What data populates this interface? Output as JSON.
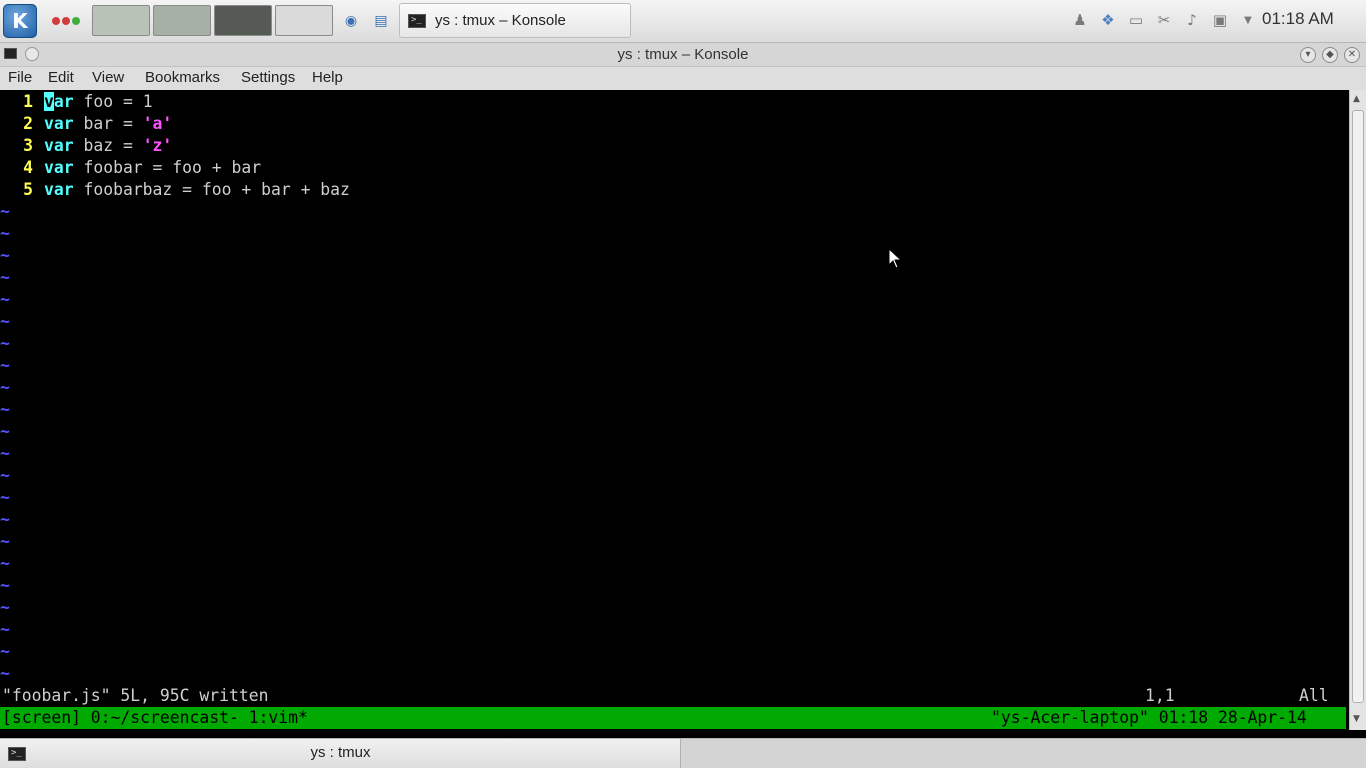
{
  "panel": {
    "launcher_icon": "kde-k-icon",
    "task_label": "ys : tmux – Konsole",
    "clock": "01:18 AM",
    "colors": {
      "red": "#d23b3b",
      "green": "#3fae3f",
      "blue": "#3b6fd2"
    }
  },
  "window": {
    "title": "ys : tmux – Konsole"
  },
  "menu": {
    "file": "File",
    "edit": "Edit",
    "view": "View",
    "bookmarks": "Bookmarks",
    "settings": "Settings",
    "help": "Help"
  },
  "editor": {
    "lines": [
      {
        "num": "1",
        "kw": "var",
        "rest": " foo = 1"
      },
      {
        "num": "2",
        "kw": "var",
        "pre": " bar = ",
        "str": "'a'"
      },
      {
        "num": "3",
        "kw": "var",
        "pre": " baz = ",
        "str": "'z'"
      },
      {
        "num": "4",
        "kw": "var",
        "rest": " foobar = foo + bar"
      },
      {
        "num": "5",
        "kw": "var",
        "rest": " foobarbaz = foo + bar + baz"
      }
    ],
    "tilde": "~",
    "message": "\"foobar.js\" 5L, 95C written",
    "position": "1,1",
    "scroll": "All"
  },
  "tmux": {
    "left": "[screen] 0:~/screencast- 1:vim*",
    "right": "\"ys-Acer-laptop\" 01:18 28-Apr-14",
    "color": "#00aa00"
  },
  "bottom_bar": {
    "tab_label": "ys : tmux"
  }
}
